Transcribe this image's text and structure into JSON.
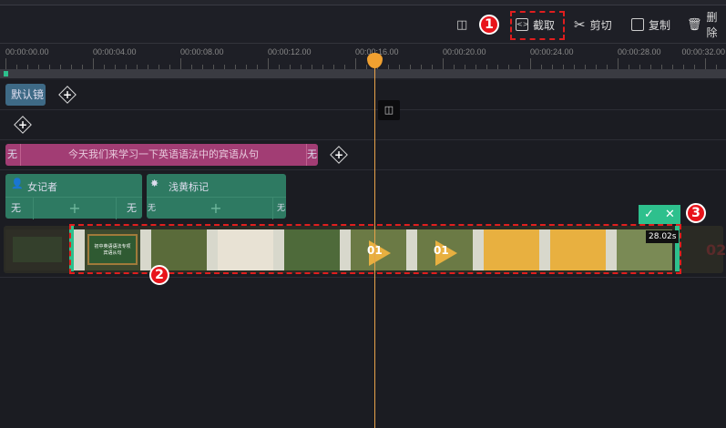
{
  "toolbar": {
    "split_icon": "split-icon",
    "crop_label": "截取",
    "cut_label": "剪切",
    "copy_label": "复制",
    "delete_label": "删除"
  },
  "annotations": {
    "one": "1",
    "two": "2",
    "three": "3"
  },
  "ruler": {
    "labels": [
      "00:00:00.00",
      "00:00:04.00",
      "00:00:08.00",
      "00:00:12.00",
      "00:00:16.00",
      "00:00:20.00",
      "00:00:24.00",
      "00:00:28.00",
      "00:00:32.00"
    ]
  },
  "tracks": {
    "camera_clip": "默认镜",
    "subtitle": {
      "text": "今天我们来学习一下英语语法中的宾语从句",
      "left": "无",
      "right": "无"
    },
    "char1": {
      "name": "女记者",
      "left": "无",
      "right": "无",
      "plus": "+"
    },
    "char2": {
      "name": "浅黄标记",
      "left": "无",
      "right": "无",
      "plus": "+"
    },
    "video": {
      "duration": "28.02s",
      "slide1_title": "初中英语语法专项",
      "slide1_sub": "宾语从句",
      "num": "01",
      "num2": "02"
    }
  },
  "confirm": {
    "ok": "✓",
    "cancel": "✕"
  },
  "colors": {
    "accent": "#2ec08d",
    "subtitle": "#a23d74",
    "char": "#2e7a62",
    "camera": "#3e6a86",
    "playhead": "#e8a24a",
    "annotation": "#e01e1e"
  }
}
